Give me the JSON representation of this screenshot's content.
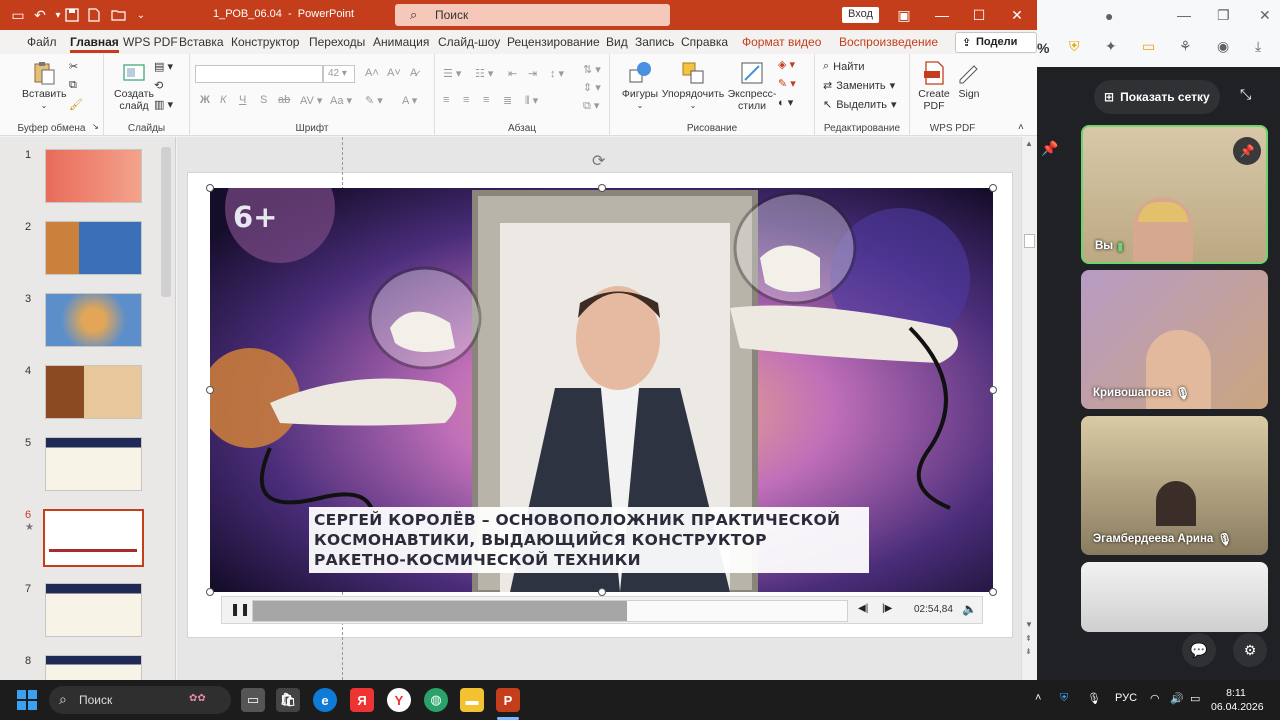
{
  "titlebar": {
    "doc_name": "1_РОВ_06.04",
    "app_sep": "-",
    "app_name": "PowerPoint",
    "search_placeholder": "Поиск",
    "login_label": "Вход"
  },
  "tabs": [
    "Файл",
    "Главная",
    "WPS PDF",
    "Вставка",
    "Конструктор",
    "Переходы",
    "Анимация",
    "Слайд-шоу",
    "Рецензирование",
    "Вид",
    "Запись",
    "Справка"
  ],
  "active_tab": "Главная",
  "context_tabs": [
    "Формат видео",
    "Воспроизведение"
  ],
  "share_label": "Подели",
  "ribbon": {
    "clipboard": {
      "paste": "Вставить",
      "group": "Буфер обмена"
    },
    "slides": {
      "new_slide_line1": "Создать",
      "new_slide_line2": "слайд",
      "group": "Слайды"
    },
    "font": {
      "font_size": "42",
      "bold": "Ж",
      "italic": "К",
      "underline": "Ч",
      "strike": "S",
      "group": "Шрифт"
    },
    "paragraph": {
      "group": "Абзац"
    },
    "drawing": {
      "shapes": "Фигуры",
      "arrange": "Упорядочить",
      "quick_styles_line1": "Экспресс-",
      "quick_styles_line2": "стили",
      "group": "Рисование"
    },
    "editing": {
      "find": "Найти",
      "replace": "Заменить",
      "select": "Выделить",
      "group": "Редактирование"
    },
    "wps": {
      "create_pdf_line1": "Create",
      "create_pdf_line2": "PDF",
      "sign": "Sign",
      "group": "WPS PDF"
    }
  },
  "slides": [
    {
      "num": "1",
      "mark": ""
    },
    {
      "num": "2",
      "mark": ""
    },
    {
      "num": "3",
      "mark": ""
    },
    {
      "num": "4",
      "mark": ""
    },
    {
      "num": "5",
      "mark": ""
    },
    {
      "num": "6",
      "mark": "★"
    },
    {
      "num": "7",
      "mark": ""
    },
    {
      "num": "8",
      "mark": ""
    }
  ],
  "selected_slide": "6",
  "video": {
    "age_rating": "6+",
    "caption_line1": "СЕРГЕЙ КОРОЛЁВ – ОСНОВОПОЛОЖНИК ПРАКТИЧЕСКОЙ",
    "caption_line2": "КОСМОНАВТИКИ, ВЫДАЮЩИЙСЯ КОНСТРУКТОР",
    "caption_line3": "РАКЕТНО-КОСМИЧЕСКОЙ ТЕХНИКИ",
    "time": "02:54,84",
    "progress_fraction": 0.63
  },
  "meeting": {
    "show_grid_label": "Показать сетку",
    "participants": [
      {
        "name": "Вы"
      },
      {
        "name": "Кривошапова"
      },
      {
        "name": "Эгамбердеева Арина"
      }
    ]
  },
  "taskbar": {
    "search_placeholder": "Поиск",
    "lang": "РУС",
    "time": "8:11",
    "date": "06.04.2026"
  },
  "colors": {
    "ppt_accent": "#c43e1c",
    "meeting_bg": "#202124",
    "active_speaker": "#6fd36f"
  }
}
